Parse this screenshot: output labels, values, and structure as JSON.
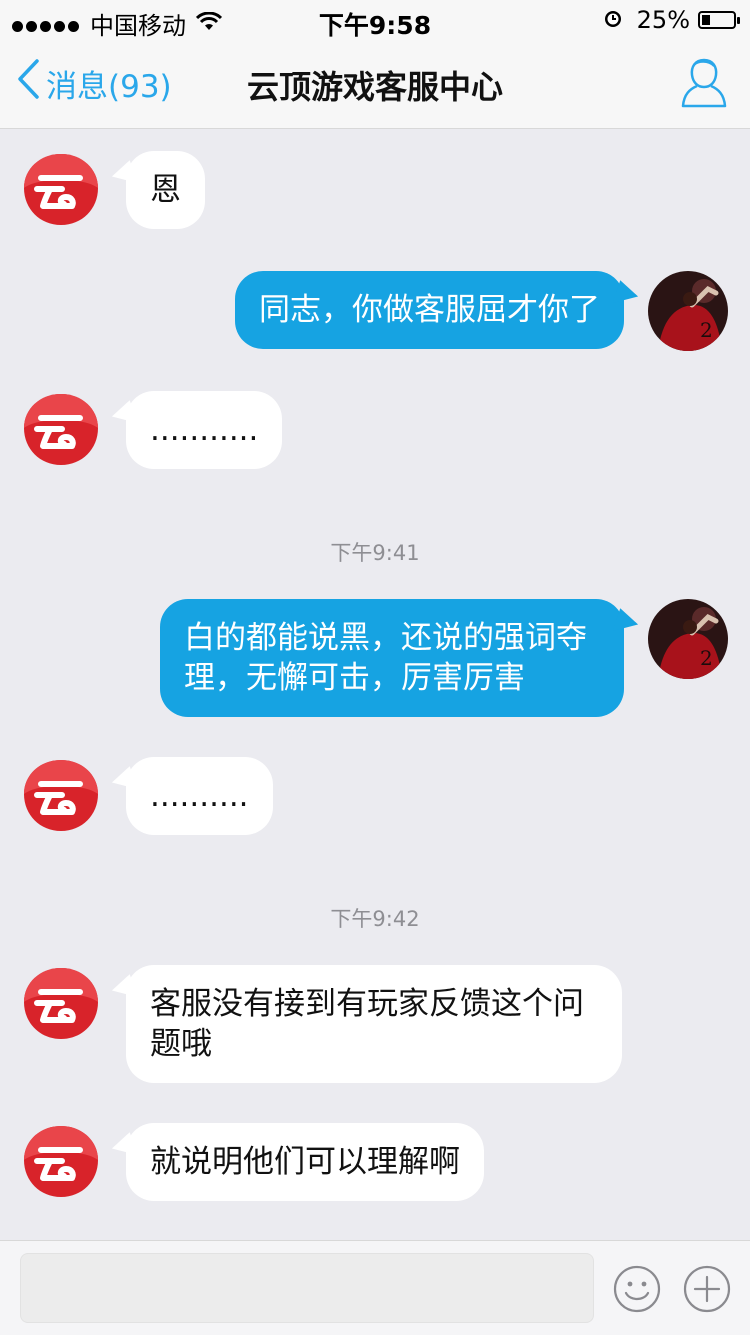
{
  "status_bar": {
    "carrier": "中国移动",
    "time": "下午9:58",
    "battery": "25%",
    "battery_level": 0.25,
    "icons": [
      "signal-dots-icon",
      "wifi-icon",
      "alarm-icon",
      "battery-icon"
    ]
  },
  "nav": {
    "back_label": "消息(93)",
    "title": "云顶游戏客服中心",
    "icons": [
      "chevron-left-icon",
      "profile-icon"
    ]
  },
  "messages": [
    {
      "side": "in",
      "text": "恩"
    },
    {
      "side": "out",
      "text": "同志，你做客服屈才你了"
    },
    {
      "side": "in",
      "text": "..........."
    },
    {
      "timestamp": "下午9:41"
    },
    {
      "side": "out",
      "text": "白的都能说黑，还说的强词夺理，无懈可击，厉害厉害"
    },
    {
      "side": "in",
      "text": ".........."
    },
    {
      "timestamp": "下午9:42"
    },
    {
      "side": "in",
      "text": "客服没有接到有玩家反馈这个问题哦"
    },
    {
      "side": "in",
      "text": "就说明他们可以理解啊"
    }
  ],
  "input": {
    "value": "",
    "placeholder": "",
    "icons": [
      "emoji-icon",
      "plus-icon"
    ]
  },
  "colors": {
    "accent": "#2aa7ea",
    "outgoing_bubble": "#16a3e2",
    "incoming_bubble": "#ffffff",
    "background": "#ebebf0",
    "service_avatar_red": "#d8232a"
  }
}
